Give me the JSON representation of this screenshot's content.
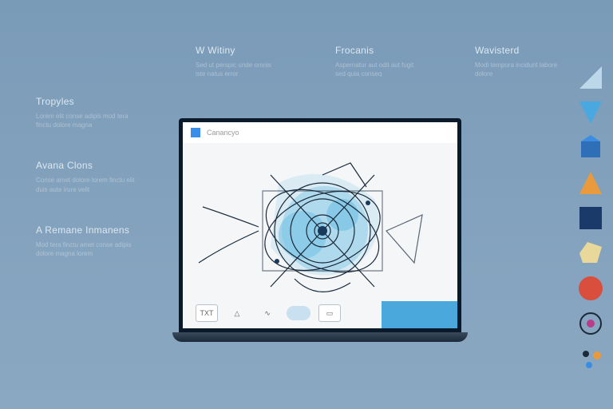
{
  "left_features": [
    {
      "title": "Tropyles",
      "body": "Lorem elit conse adipis mod tera finctu dolore magna"
    },
    {
      "title": "Avana Clons",
      "body": "Conse amet dolore lorem finctu elit duis aute irure velit"
    },
    {
      "title": "A Remane Inmanens",
      "body": "Mod tera finctu amet conse adipis dolore magna lorem"
    }
  ],
  "top_features": [
    {
      "title": "W Witiny",
      "body": "Sed ut perspic unde omnis iste natus error"
    },
    {
      "title": "Frocanis",
      "body": "Aspernatur aut odit aut fugit sed quia conseq"
    },
    {
      "title": "Wavisterd",
      "body": "Modi tempora incidunt labore dolore"
    }
  ],
  "app": {
    "tab_label": "Canancyo"
  },
  "tools": {
    "text": "TXT",
    "triangle": "△",
    "curve": "∿",
    "rect": "▭"
  },
  "palette_colors": [
    "#bcd7e8",
    "#4aa8e0",
    "#2e6fb8",
    "#e89a3c",
    "#1a3a6a",
    "#e8d89a",
    "#d94e3c",
    "#b83c8a"
  ]
}
